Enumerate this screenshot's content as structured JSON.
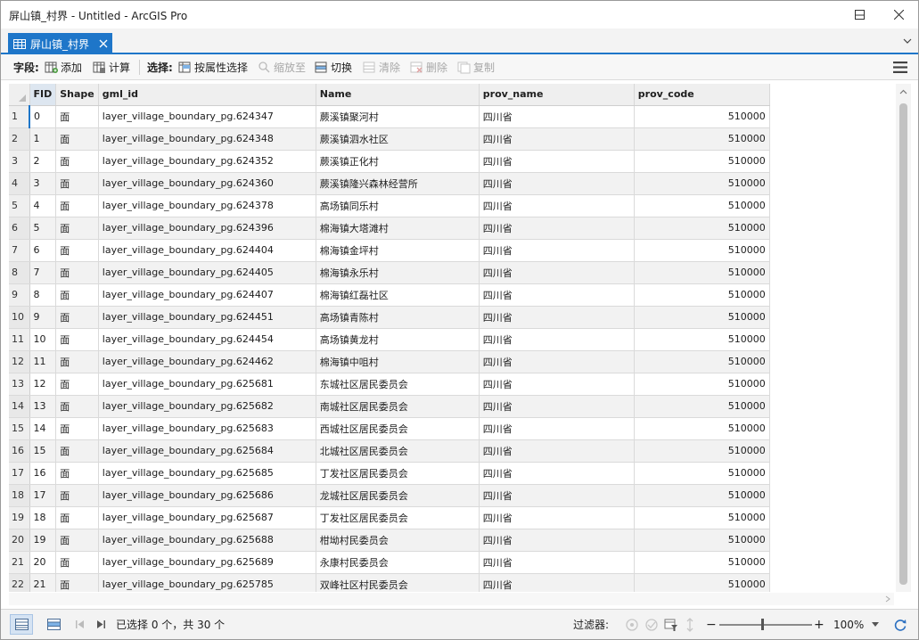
{
  "window": {
    "title": "屏山镇_村界 - Untitled - ArcGIS Pro"
  },
  "tab": {
    "label": "屏山镇_村界"
  },
  "toolbar": {
    "field_label": "字段:",
    "add_label": "添加",
    "calculate_label": "计算",
    "selection_label": "选择:",
    "select_by_attr_label": "按属性选择",
    "zoom_to_label": "缩放至",
    "switch_label": "切换",
    "clear_label": "清除",
    "delete_label": "删除",
    "copy_label": "复制"
  },
  "table": {
    "columns": [
      "FID",
      "Shape",
      "gml_id",
      "Name",
      "prov_name",
      "prov_code"
    ],
    "rows": [
      {
        "n": "1",
        "fid": "0",
        "shape": "面",
        "gml_id": "layer_village_boundary_pg.624347",
        "name": "蕨溪镇聚河村",
        "prov_name": "四川省",
        "prov_code": "510000"
      },
      {
        "n": "2",
        "fid": "1",
        "shape": "面",
        "gml_id": "layer_village_boundary_pg.624348",
        "name": "蕨溪镇泗水社区",
        "prov_name": "四川省",
        "prov_code": "510000"
      },
      {
        "n": "3",
        "fid": "2",
        "shape": "面",
        "gml_id": "layer_village_boundary_pg.624352",
        "name": "蕨溪镇正化村",
        "prov_name": "四川省",
        "prov_code": "510000"
      },
      {
        "n": "4",
        "fid": "3",
        "shape": "面",
        "gml_id": "layer_village_boundary_pg.624360",
        "name": "蕨溪镇隆兴森林经营所",
        "prov_name": "四川省",
        "prov_code": "510000"
      },
      {
        "n": "5",
        "fid": "4",
        "shape": "面",
        "gml_id": "layer_village_boundary_pg.624378",
        "name": "高场镇同乐村",
        "prov_name": "四川省",
        "prov_code": "510000"
      },
      {
        "n": "6",
        "fid": "5",
        "shape": "面",
        "gml_id": "layer_village_boundary_pg.624396",
        "name": "棉海镇大塔滩村",
        "prov_name": "四川省",
        "prov_code": "510000"
      },
      {
        "n": "7",
        "fid": "6",
        "shape": "面",
        "gml_id": "layer_village_boundary_pg.624404",
        "name": "棉海镇金坪村",
        "prov_name": "四川省",
        "prov_code": "510000"
      },
      {
        "n": "8",
        "fid": "7",
        "shape": "面",
        "gml_id": "layer_village_boundary_pg.624405",
        "name": "棉海镇永乐村",
        "prov_name": "四川省",
        "prov_code": "510000"
      },
      {
        "n": "9",
        "fid": "8",
        "shape": "面",
        "gml_id": "layer_village_boundary_pg.624407",
        "name": "棉海镇红磊社区",
        "prov_name": "四川省",
        "prov_code": "510000"
      },
      {
        "n": "10",
        "fid": "9",
        "shape": "面",
        "gml_id": "layer_village_boundary_pg.624451",
        "name": "高场镇青陈村",
        "prov_name": "四川省",
        "prov_code": "510000"
      },
      {
        "n": "11",
        "fid": "10",
        "shape": "面",
        "gml_id": "layer_village_boundary_pg.624454",
        "name": "高场镇黄龙村",
        "prov_name": "四川省",
        "prov_code": "510000"
      },
      {
        "n": "12",
        "fid": "11",
        "shape": "面",
        "gml_id": "layer_village_boundary_pg.624462",
        "name": "棉海镇中咀村",
        "prov_name": "四川省",
        "prov_code": "510000"
      },
      {
        "n": "13",
        "fid": "12",
        "shape": "面",
        "gml_id": "layer_village_boundary_pg.625681",
        "name": "东城社区居民委员会",
        "prov_name": "四川省",
        "prov_code": "510000"
      },
      {
        "n": "14",
        "fid": "13",
        "shape": "面",
        "gml_id": "layer_village_boundary_pg.625682",
        "name": "南城社区居民委员会",
        "prov_name": "四川省",
        "prov_code": "510000"
      },
      {
        "n": "15",
        "fid": "14",
        "shape": "面",
        "gml_id": "layer_village_boundary_pg.625683",
        "name": "西城社区居民委员会",
        "prov_name": "四川省",
        "prov_code": "510000"
      },
      {
        "n": "16",
        "fid": "15",
        "shape": "面",
        "gml_id": "layer_village_boundary_pg.625684",
        "name": "北城社区居民委员会",
        "prov_name": "四川省",
        "prov_code": "510000"
      },
      {
        "n": "17",
        "fid": "16",
        "shape": "面",
        "gml_id": "layer_village_boundary_pg.625685",
        "name": "丁发社区居民委员会",
        "prov_name": "四川省",
        "prov_code": "510000"
      },
      {
        "n": "18",
        "fid": "17",
        "shape": "面",
        "gml_id": "layer_village_boundary_pg.625686",
        "name": "龙城社区居民委员会",
        "prov_name": "四川省",
        "prov_code": "510000"
      },
      {
        "n": "19",
        "fid": "18",
        "shape": "面",
        "gml_id": "layer_village_boundary_pg.625687",
        "name": "丁发社区居民委员会",
        "prov_name": "四川省",
        "prov_code": "510000"
      },
      {
        "n": "20",
        "fid": "19",
        "shape": "面",
        "gml_id": "layer_village_boundary_pg.625688",
        "name": "柑坳村民委员会",
        "prov_name": "四川省",
        "prov_code": "510000"
      },
      {
        "n": "21",
        "fid": "20",
        "shape": "面",
        "gml_id": "layer_village_boundary_pg.625689",
        "name": "永康村民委员会",
        "prov_name": "四川省",
        "prov_code": "510000"
      },
      {
        "n": "22",
        "fid": "21",
        "shape": "面",
        "gml_id": "layer_village_boundary_pg.625785",
        "name": "双峰社区村民委员会",
        "prov_name": "四川省",
        "prov_code": "510000"
      }
    ]
  },
  "status": {
    "selection_text": "已选择 0 个，共 30 个",
    "filter_label": "过滤器:",
    "zoom_minus": "−",
    "zoom_plus": "+",
    "zoom_value": "100%"
  },
  "colors": {
    "accent": "#1e76c9",
    "refresh": "#2a6fc0"
  }
}
